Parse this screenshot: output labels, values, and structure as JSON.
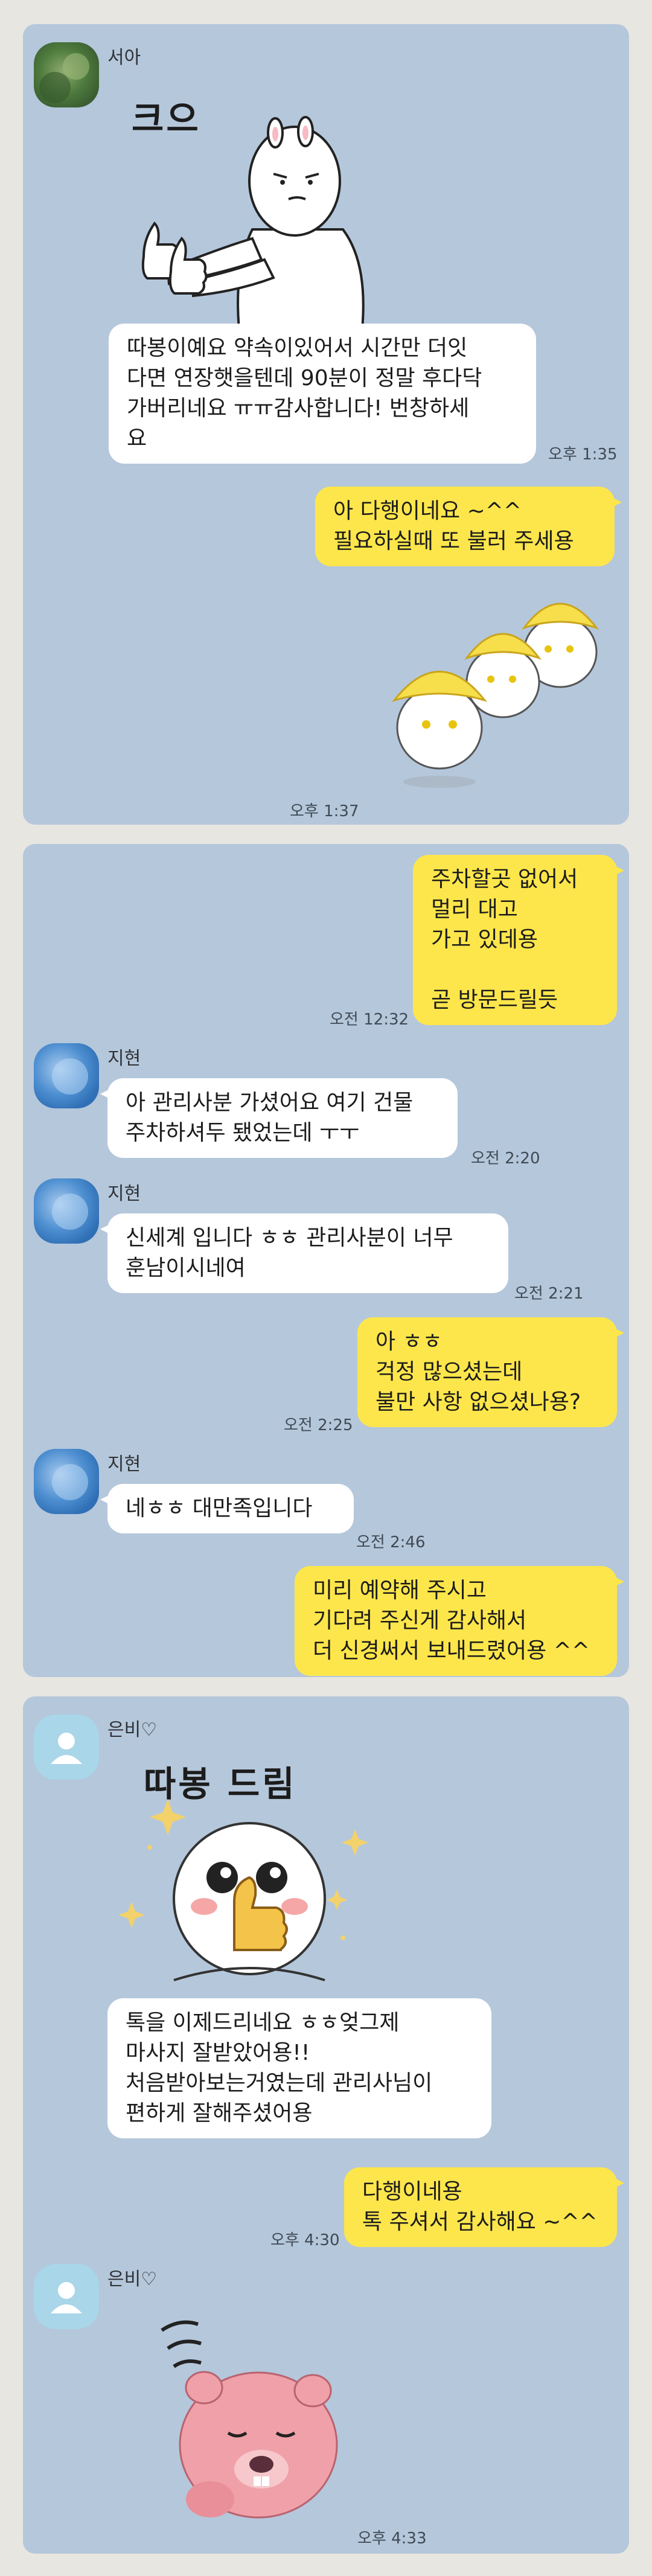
{
  "chat1": {
    "sender": "서아",
    "sticker_caption": "크으",
    "msg_in": "따봉이예요 약속이있어서 시간만 더잇\n다면 연장햇을텐데 90분이 정말 후다닥\n가버리네요 ㅠㅠ감사합니다! 번창하세\n요",
    "msg_in_time": "오후 1:35",
    "msg_out": "아 다행이네요 ~^^\n필요하실때 또 불러 주세용",
    "sticker_time": "오후 1:37"
  },
  "chat2": {
    "out1": "주차할곳 없어서\n멀리 대고\n가고 있데용\n\n곧 방문드릴듯",
    "out1_time": "오전 12:32",
    "sender": "지현",
    "in1": "아 관리사분 가셨어요 여기 건물\n주차하셔두 됐었는데 ㅜㅜ",
    "in1_time": "오전 2:20",
    "in2": "신세계 입니다 ㅎㅎ 관리사분이 너무\n훈남이시네여",
    "in2_time": "오전 2:21",
    "out2": "아 ㅎㅎ\n걱정 많으셨는데\n불만 사항 없으셨나용?",
    "out2_time": "오전 2:25",
    "in3": "네ㅎㅎ 대만족입니다",
    "in3_time": "오전 2:46",
    "out3": "미리 예약해 주시고\n기다려 주신게 감사해서\n더 신경써서 보내드렸어용 ^^"
  },
  "chat3": {
    "sender": "은비♡",
    "sticker_caption": "따봉 드림",
    "in1": "톡을 이제드리네요 ㅎㅎ엊그제\n마사지 잘받았어용!!\n처음받아보는거였는데 관리사님이\n편하게 잘해주셨어용",
    "out1": "다행이네용\n톡 주셔서 감사해요 ~^^",
    "out1_time": "오후 4:30",
    "sticker_time": "오후 4:33"
  },
  "colors": {
    "chat_bg": "#b5c7db",
    "outgoing_bubble": "#fde64b",
    "incoming_bubble": "#ffffff"
  }
}
